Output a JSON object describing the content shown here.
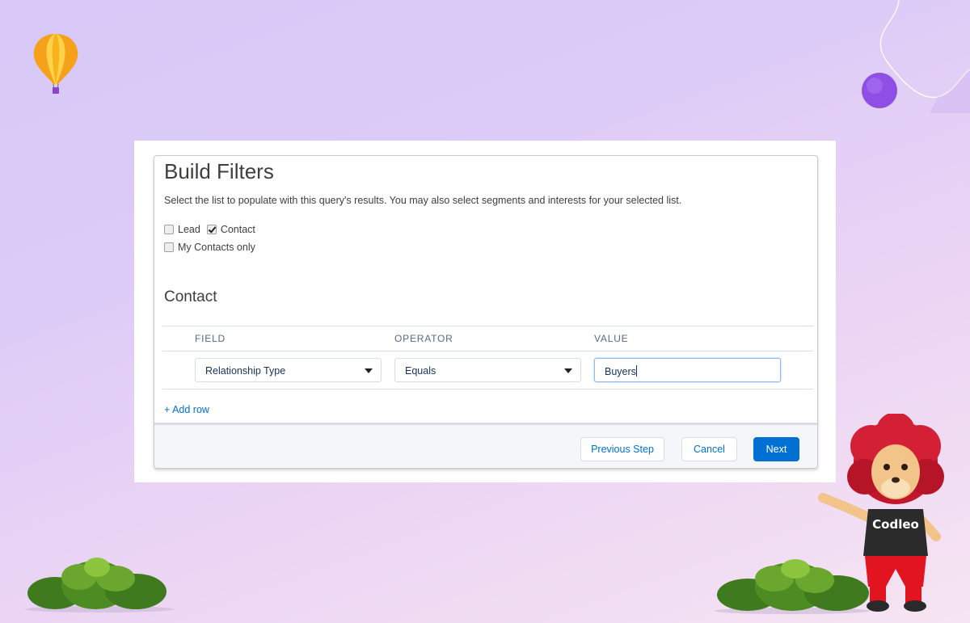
{
  "filter": {
    "title": "Build Filters",
    "description": "Select the list to populate with this query's results. You may also select segments and interests for your selected list.",
    "checkboxes": [
      {
        "label": "Lead",
        "checked": false
      },
      {
        "label": "Contact",
        "checked": true
      },
      {
        "label": "My Contacts only",
        "checked": false
      }
    ],
    "section_title": "Contact",
    "columns": {
      "field": "FIELD",
      "operator": "OPERATOR",
      "value": "VALUE"
    },
    "row": {
      "field": "Relationship Type",
      "operator": "Equals",
      "value": "Buyers"
    },
    "add_row": "+ Add row"
  },
  "footer": {
    "previous": "Previous Step",
    "cancel": "Cancel",
    "next": "Next"
  },
  "mascot": {
    "shirt_text": "Codleo"
  },
  "colors": {
    "brand": "#0070d2",
    "link": "#0070d2",
    "header_text": "#54698d"
  }
}
